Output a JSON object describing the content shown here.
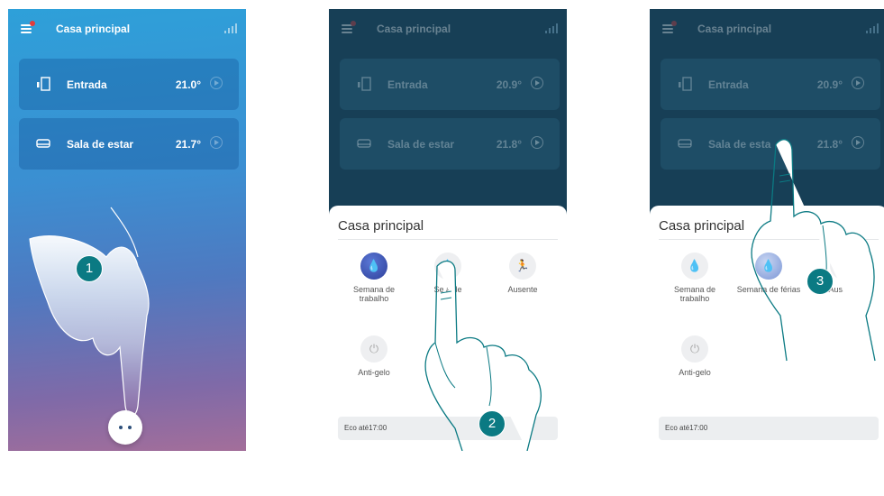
{
  "screens": [
    {
      "header": {
        "title": "Casa principal"
      },
      "rooms": [
        {
          "name": "Entrada",
          "temp": "21.0°"
        },
        {
          "name": "Sala de estar",
          "temp": "21.7°"
        }
      ],
      "step": "1"
    },
    {
      "header": {
        "title": "Casa principal"
      },
      "rooms": [
        {
          "name": "Entrada",
          "temp": "20.9°"
        },
        {
          "name": "Sala de estar",
          "temp": "21.8°"
        }
      ],
      "sheet": {
        "title": "Casa principal",
        "modes": [
          {
            "label": "Semana de trabalho",
            "icon": "flame-icon"
          },
          {
            "label": "Se   a de",
            "icon": "flame-icon"
          },
          {
            "label": "Ausente",
            "icon": "walking-person-icon"
          },
          {
            "label": "Anti-gelo",
            "icon": "power-icon"
          }
        ],
        "status": "Eco até17:00"
      },
      "step": "2"
    },
    {
      "header": {
        "title": "Casa principal"
      },
      "rooms": [
        {
          "name": "Entrada",
          "temp": "20.9°"
        },
        {
          "name": "Sala de esta",
          "temp": "21.8°"
        }
      ],
      "sheet": {
        "title": "Casa principal",
        "modes": [
          {
            "label": "Semana de trabalho",
            "icon": "flame-icon"
          },
          {
            "label": "Semana de férias",
            "icon": "flame-icon"
          },
          {
            "label": "Ausente",
            "icon": "walking-person-icon"
          },
          {
            "label": "Anti-gelo",
            "icon": "power-icon"
          }
        ],
        "status": "Eco até17:00"
      },
      "step": "3"
    }
  ],
  "colors": {
    "accent": "#0b7a83",
    "active_mode": "#3b4fb0",
    "dark_bg": "#173f56"
  }
}
